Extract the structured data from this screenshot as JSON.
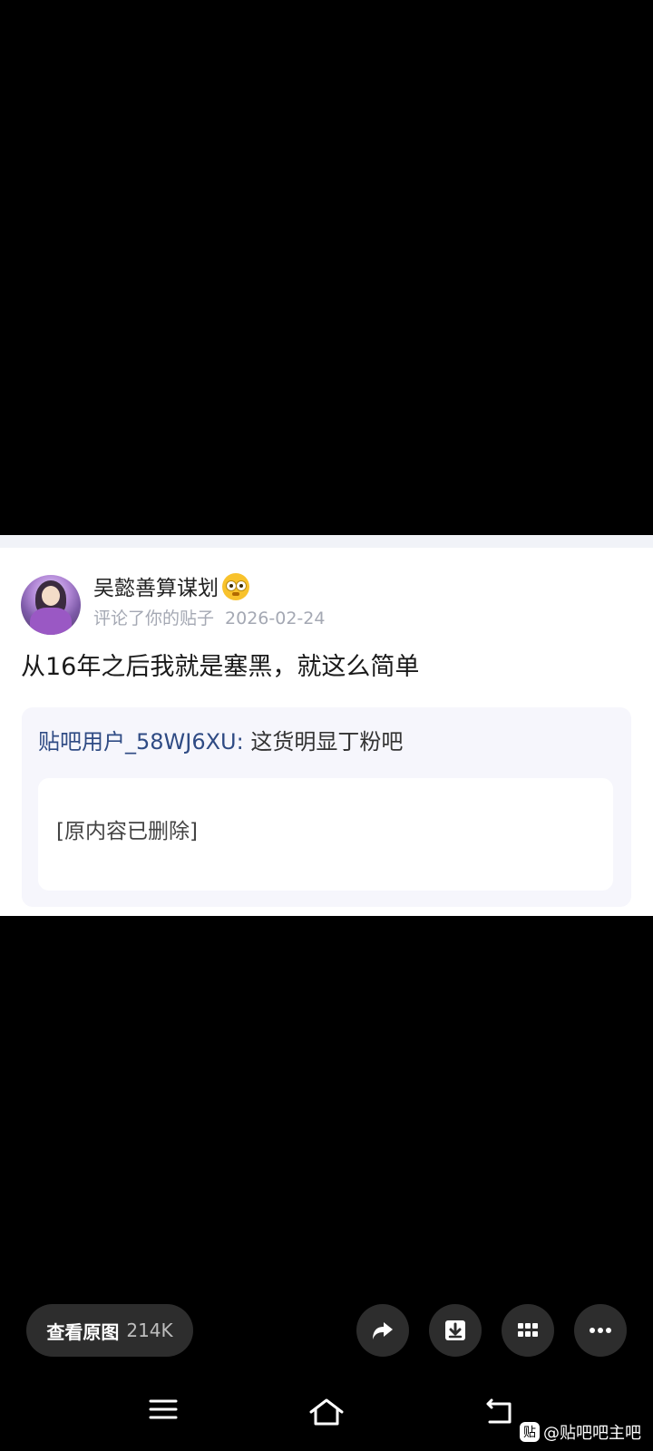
{
  "post": {
    "username": "吴懿善算谋划",
    "action": "评论了你的贴子",
    "date": "2026-02-24",
    "comment": "从16年之后我就是塞黑，就这么简单",
    "quote": {
      "user": "贴吧用户_58WJ6XU:",
      "text": " 这货明显丁粉吧",
      "original": "[原内容已删除]"
    }
  },
  "toolbar": {
    "view_original_label": "查看原图",
    "view_original_size": "214K",
    "icons": [
      "share-icon",
      "download-icon",
      "grid-icon",
      "more-icon"
    ]
  },
  "navbar": {
    "icons": [
      "menu-icon",
      "home-icon",
      "back-icon"
    ]
  },
  "watermark": {
    "logo_text": "贴",
    "text": "@贴吧吧主吧"
  },
  "colors": {
    "background": "#000000",
    "card": "#ffffff",
    "quote_bg": "#f6f6fc",
    "link_blue": "#2f4b84",
    "meta_gray": "#a4a8b3",
    "button_bg": "#2d2d2d"
  }
}
